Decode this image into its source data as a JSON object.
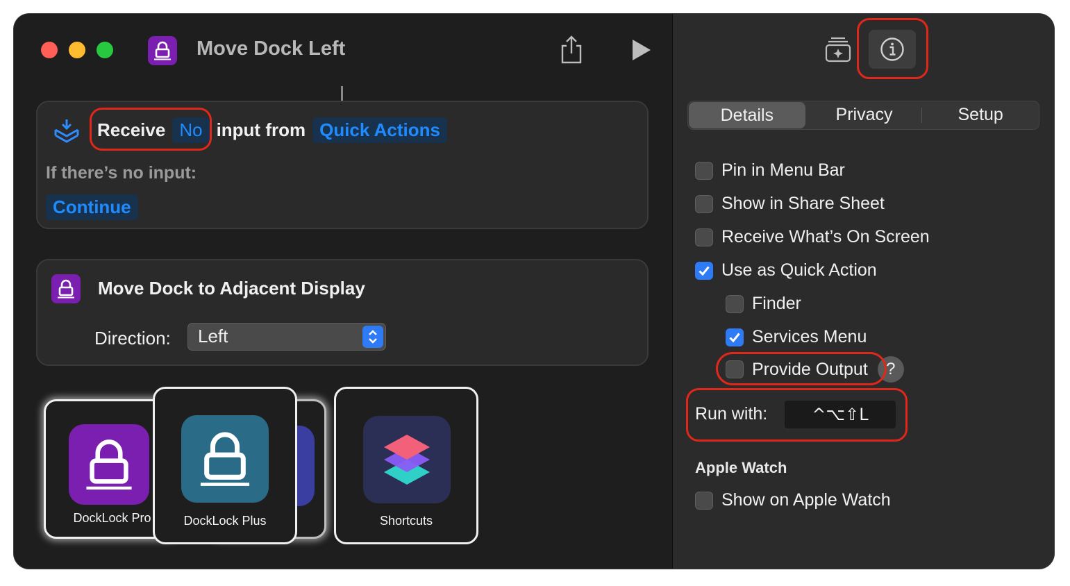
{
  "window": {
    "title": "Move Dock Left"
  },
  "receive_card": {
    "receive_label": "Receive",
    "input_value": "No",
    "input_from_label": "input from",
    "source_value": "Quick Actions",
    "no_input_label": "If there’s no input:",
    "no_input_action": "Continue"
  },
  "action_card": {
    "title": "Move Dock to Adjacent Display",
    "direction_label": "Direction:",
    "direction_value": "Left"
  },
  "app_switcher": {
    "apps": [
      {
        "label": "DockLock Pro",
        "icon": "docklock-pro-icon",
        "color": "#7a1fb0"
      },
      {
        "label": "DockLock Plus",
        "icon": "docklock-plus-icon",
        "color": "#2a6b88"
      },
      {
        "label": "Shortcuts",
        "icon": "shortcuts-app-icon",
        "color": "#2c2f55"
      }
    ]
  },
  "inspector": {
    "tabs": [
      {
        "label": "Details",
        "active": true
      },
      {
        "label": "Privacy",
        "active": false
      },
      {
        "label": "Setup",
        "active": false
      }
    ],
    "options": {
      "pin_menu_bar": {
        "label": "Pin in Menu Bar",
        "checked": false
      },
      "share_sheet": {
        "label": "Show in Share Sheet",
        "checked": false
      },
      "whats_on_screen": {
        "label": "Receive What’s On Screen",
        "checked": false
      },
      "quick_action": {
        "label": "Use as Quick Action",
        "checked": true
      },
      "finder": {
        "label": "Finder",
        "checked": false
      },
      "services_menu": {
        "label": "Services Menu",
        "checked": true
      },
      "provide_output": {
        "label": "Provide Output",
        "checked": false
      }
    },
    "help_label": "?",
    "run_with_label": "Run with:",
    "shortcut_keys": "^⌥⇧L",
    "apple_watch_heading": "Apple Watch",
    "apple_watch_option": {
      "label": "Show on Apple Watch",
      "checked": false
    }
  },
  "colors": {
    "accent": "#2f7bf6",
    "token_text": "#1f8bff",
    "highlight": "#e0281a",
    "app_purple": "#7a1fb0"
  }
}
